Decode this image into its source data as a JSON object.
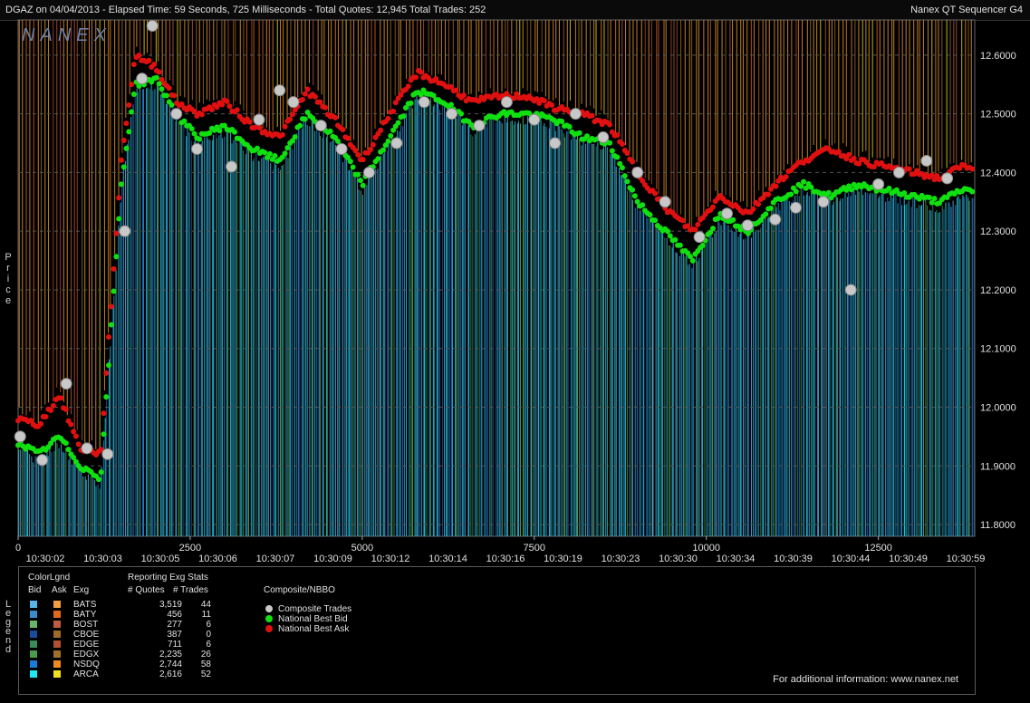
{
  "header": {
    "title": "DGAZ on 04/04/2013  -  Elapsed Time: 59 Seconds, 725 Milliseconds  -  Total Quotes: 12,945  Total Trades: 252",
    "app_name": "Nanex QT Sequencer G4"
  },
  "logo": "NANEX",
  "side_labels": {
    "price": "Price",
    "legend": "Legend"
  },
  "footer": {
    "info": "For additional information: www.nanex.net"
  },
  "legend": {
    "title_color": "ColorLgnd",
    "col_bid": "Bid",
    "col_ask": "Ask",
    "col_exg": "Exg",
    "stats_title": "Reporting Exg Stats",
    "col_quotes": "# Quotes",
    "col_trades": "# Trades",
    "composite_title": "Composite/NBBO",
    "exchanges": [
      {
        "name": "BATS",
        "quotes": "3,519",
        "trades": "44",
        "bid_color": "#5ab4e8",
        "ask_color": "#f0a040"
      },
      {
        "name": "BATY",
        "quotes": "456",
        "trades": "11",
        "bid_color": "#3c8ccc",
        "ask_color": "#e06a1a"
      },
      {
        "name": "BOST",
        "quotes": "277",
        "trades": "6",
        "bid_color": "#6ab46a",
        "ask_color": "#c05a40"
      },
      {
        "name": "CBOE",
        "quotes": "387",
        "trades": "0",
        "bid_color": "#1a4c9c",
        "ask_color": "#a06a28"
      },
      {
        "name": "EDGE",
        "quotes": "711",
        "trades": "6",
        "bid_color": "#3a8a5a",
        "ask_color": "#b05030"
      },
      {
        "name": "EDGX",
        "quotes": "2,235",
        "trades": "26",
        "bid_color": "#4a9a4a",
        "ask_color": "#a0702a"
      },
      {
        "name": "NSDQ",
        "quotes": "2,744",
        "trades": "58",
        "bid_color": "#1e7ad8",
        "ask_color": "#f08a20"
      },
      {
        "name": "ARCA",
        "quotes": "2,616",
        "trades": "52",
        "bid_color": "#20e8f0",
        "ask_color": "#f0e020"
      }
    ],
    "composite": [
      {
        "label": "Composite Trades",
        "color": "#c8c8c8"
      },
      {
        "label": "National Best Bid",
        "color": "#10e010"
      },
      {
        "label": "National Best Ask",
        "color": "#e01010"
      }
    ]
  },
  "colors": {
    "bid_lines": "#30c0e8",
    "ask_lines": "#f0a030",
    "nbb": "#10e010",
    "nba": "#e01010",
    "trade": "#c8c8c8",
    "grid": "#555555"
  },
  "chart_data": {
    "type": "scatter",
    "x_axis_sequence": {
      "ticks": [
        0,
        2500,
        5000,
        7500,
        10000,
        12500
      ],
      "range": [
        0,
        13900
      ]
    },
    "x_axis_time_labels": [
      "10:30:02",
      "10:30:03",
      "10:30:05",
      "10:30:06",
      "10:30:07",
      "10:30:09",
      "10:30:12",
      "10:30:14",
      "10:30:16",
      "10:30:19",
      "10:30:23",
      "10:30:30",
      "10:30:34",
      "10:30:39",
      "10:30:44",
      "10:30:49",
      "10:30:59"
    ],
    "ylabel": "Price",
    "ylim": [
      11.78,
      12.66
    ],
    "y_ticks": [
      "11.8000",
      "11.9000",
      "12.0000",
      "12.1000",
      "12.2000",
      "12.3000",
      "12.4000",
      "12.5000",
      "12.6000"
    ],
    "grid": true,
    "series": [
      {
        "name": "National Best Bid",
        "x": [
          0,
          300,
          600,
          900,
          1200,
          1500,
          1700,
          2000,
          2300,
          2600,
          3000,
          3400,
          3800,
          4200,
          4600,
          5000,
          5400,
          5800,
          6200,
          6600,
          7000,
          7400,
          7800,
          8200,
          8600,
          9000,
          9400,
          9800,
          10200,
          10600,
          11000,
          11400,
          11800,
          12200,
          12600,
          13000,
          13400,
          13700
        ],
        "y": [
          11.94,
          11.92,
          11.95,
          11.9,
          11.88,
          12.38,
          12.55,
          12.56,
          12.5,
          12.46,
          12.48,
          12.44,
          12.42,
          12.5,
          12.46,
          12.38,
          12.46,
          12.54,
          12.52,
          12.48,
          12.5,
          12.5,
          12.49,
          12.46,
          12.45,
          12.35,
          12.3,
          12.25,
          12.33,
          12.3,
          12.35,
          12.38,
          12.36,
          12.38,
          12.37,
          12.36,
          12.35,
          12.37
        ]
      },
      {
        "name": "National Best Ask",
        "x": [
          0,
          300,
          600,
          900,
          1200,
          1500,
          1700,
          2000,
          2300,
          2600,
          3000,
          3400,
          3800,
          4200,
          4600,
          5000,
          5400,
          5800,
          6200,
          6600,
          7000,
          7400,
          7800,
          8200,
          8600,
          9000,
          9400,
          9800,
          10200,
          10600,
          11000,
          11400,
          11800,
          12200,
          12600,
          13000,
          13400,
          13700
        ],
        "y": [
          11.98,
          11.97,
          12.02,
          11.93,
          11.92,
          12.42,
          12.6,
          12.58,
          12.52,
          12.5,
          12.52,
          12.48,
          12.46,
          12.54,
          12.49,
          12.42,
          12.5,
          12.57,
          12.55,
          12.52,
          12.53,
          12.53,
          12.51,
          12.5,
          12.48,
          12.4,
          12.34,
          12.3,
          12.36,
          12.33,
          12.38,
          12.42,
          12.44,
          12.42,
          12.41,
          12.4,
          12.39,
          12.41
        ]
      },
      {
        "name": "Composite Trades",
        "x": [
          30,
          350,
          700,
          1000,
          1300,
          1550,
          1800,
          1950,
          2300,
          2600,
          3100,
          3500,
          3800,
          4000,
          4400,
          4700,
          5100,
          5500,
          5900,
          6300,
          6700,
          7100,
          7500,
          7800,
          8100,
          8500,
          9000,
          9400,
          9900,
          10300,
          10600,
          11000,
          11300,
          11700,
          12100,
          12500,
          12800,
          13200,
          13500
        ],
        "y": [
          11.95,
          11.91,
          12.04,
          11.93,
          11.92,
          12.3,
          12.56,
          12.65,
          12.5,
          12.44,
          12.41,
          12.49,
          12.54,
          12.52,
          12.48,
          12.44,
          12.4,
          12.45,
          12.52,
          12.5,
          12.48,
          12.52,
          12.49,
          12.45,
          12.5,
          12.46,
          12.4,
          12.35,
          12.29,
          12.33,
          12.31,
          12.32,
          12.34,
          12.35,
          12.2,
          12.38,
          12.4,
          12.42,
          12.39
        ]
      }
    ]
  }
}
